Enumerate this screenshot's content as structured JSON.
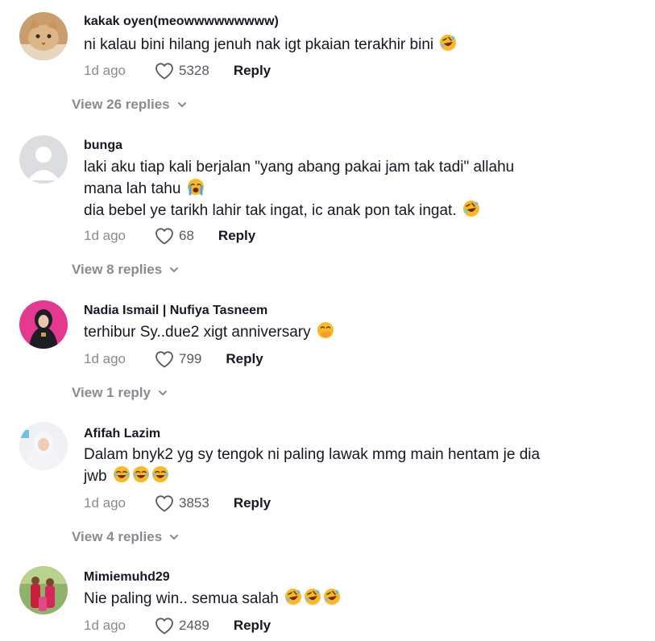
{
  "comments": [
    {
      "username": "kakak oyen(meowwwwwwwww)",
      "lines": [
        "ni kalau bini hilang jenuh nak igt pkaian terakhir bini"
      ],
      "emoji": [
        "rofl-emoji"
      ],
      "age": "1d ago",
      "likes": "5328",
      "reply": "Reply",
      "view_replies": "View 26 replies"
    },
    {
      "username": "bunga",
      "lines": [
        "laki aku tiap kali berjalan \"yang abang pakai jam tak tadi\" allahu",
        "mana lah tahu",
        "dia bebel ye tarikh lahir tak ingat, ic anak pon tak ingat."
      ],
      "emoji": [
        "loudly-crying-emoji",
        "rofl-emoji"
      ],
      "age": "1d ago",
      "likes": "68",
      "reply": "Reply",
      "view_replies": "View 8 replies"
    },
    {
      "username": "Nadia Ismail | Nufiya Tasneem",
      "lines": [
        "terhibur Sy..due2 xigt anniversary"
      ],
      "emoji": [
        "hand-over-mouth-emoji"
      ],
      "age": "1d ago",
      "likes": "799",
      "reply": "Reply",
      "view_replies": "View 1 reply"
    },
    {
      "username": "Afifah Lazim",
      "lines": [
        "Dalam bnyk2 yg sy tengok ni paling lawak mmg main hentam je dia",
        "jwb"
      ],
      "emoji": [
        "joy-emoji",
        "joy-emoji",
        "joy-emoji"
      ],
      "age": "1d ago",
      "likes": "3853",
      "reply": "Reply",
      "view_replies": "View 4 replies"
    },
    {
      "username": "Mimiemuhd29",
      "lines": [
        "Nie paling win.. semua salah"
      ],
      "emoji": [
        "rofl-emoji",
        "rofl-emoji",
        "rofl-emoji"
      ],
      "age": "1d ago",
      "likes": "2489",
      "reply": "Reply"
    }
  ],
  "icons": {
    "like": "heart-outline-icon",
    "expand": "chevron-down-icon"
  },
  "colors": {
    "text": "#161823",
    "muted": "#8a8b91",
    "emoji": "#f9b824"
  }
}
